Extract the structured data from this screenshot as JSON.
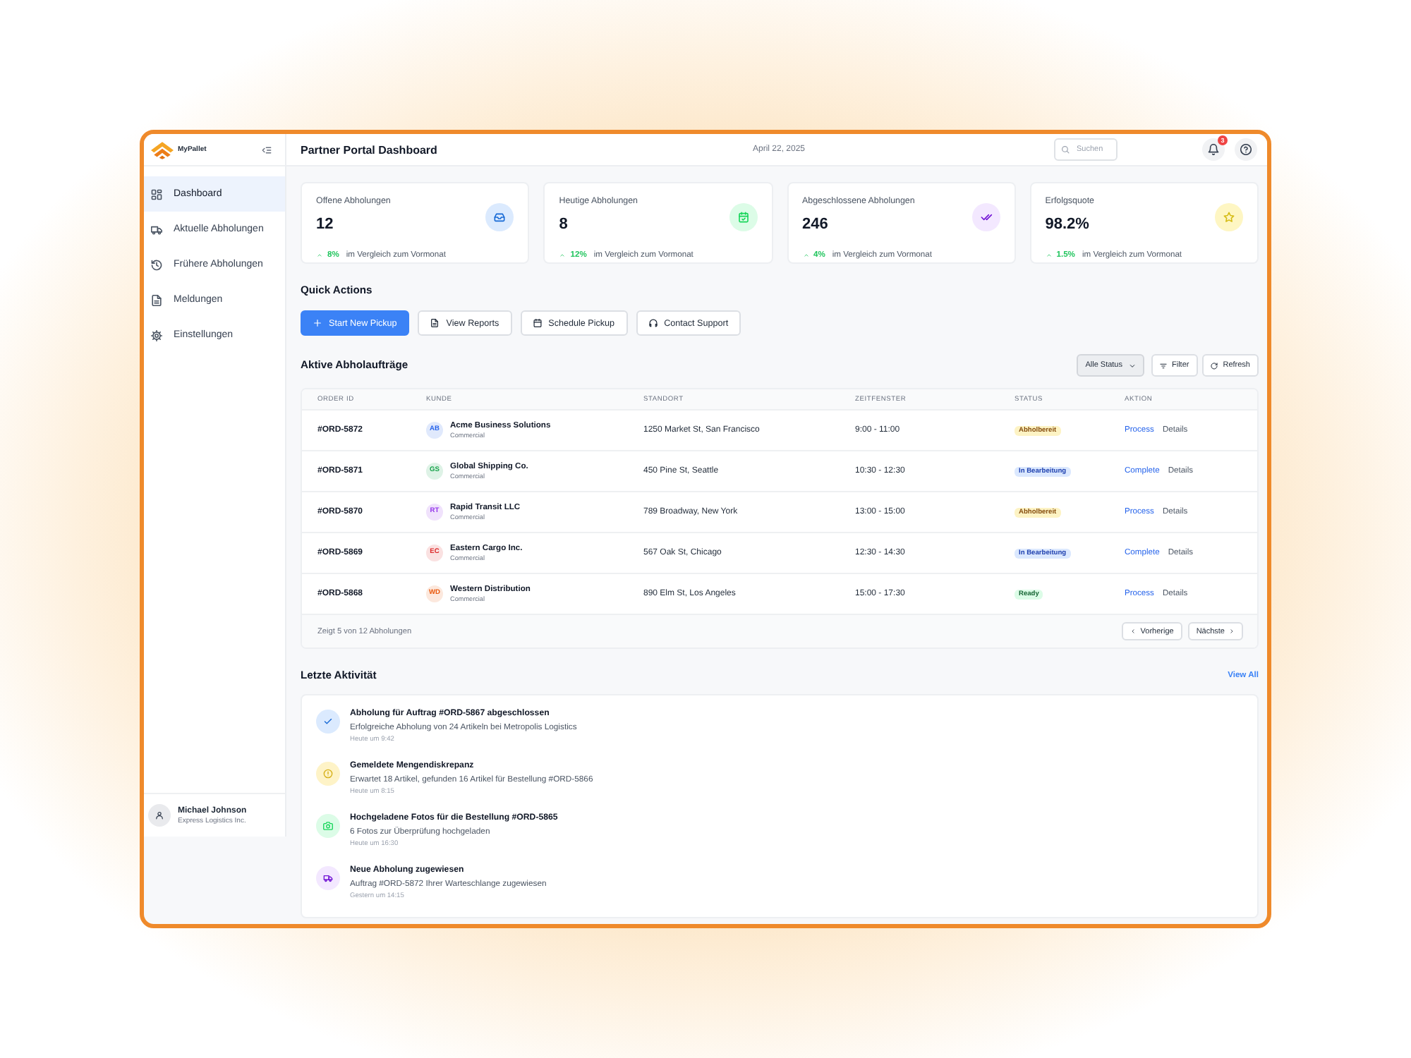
{
  "sidebar": {
    "brand": "MyPallet",
    "items": [
      {
        "label": "Dashboard",
        "selected": true
      },
      {
        "label": "Aktuelle Abholungen",
        "selected": false
      },
      {
        "label": "Frühere Abholungen",
        "selected": false
      },
      {
        "label": "Meldungen",
        "selected": false
      },
      {
        "label": "Einstellungen",
        "selected": false
      }
    ],
    "user": {
      "name": "Michael Johnson",
      "company": "Express Logistics Inc."
    }
  },
  "header": {
    "title": "Partner Portal Dashboard",
    "date": "April 22, 2025",
    "search": {
      "placeholder": "Suchen"
    },
    "notification_count": "3"
  },
  "stats": [
    {
      "label": "Offene Abholungen",
      "value": "12",
      "change": "8%",
      "note": "im Vergleich zum Vormonat",
      "color": "#dbeafe"
    },
    {
      "label": "Heutige Abholungen",
      "value": "8",
      "change": "12%",
      "note": "im Vergleich zum Vormonat",
      "color": "#dcfce7"
    },
    {
      "label": "Abgeschlossene Abholungen",
      "value": "246",
      "change": "4%",
      "note": "im Vergleich zum Vormonat",
      "color": "#f3e8ff"
    },
    {
      "label": "Erfolgsquote",
      "value": "98.2%",
      "change": "1.5%",
      "note": "im Vergleich zum Vormonat",
      "color": "#fef6c3"
    }
  ],
  "quick_actions": {
    "title": "Quick Actions",
    "buttons": [
      {
        "label": "Start New Pickup",
        "kind": "primary"
      },
      {
        "label": "View Reports",
        "kind": "outline"
      },
      {
        "label": "Schedule Pickup",
        "kind": "outline"
      },
      {
        "label": "Contact Support",
        "kind": "outline"
      }
    ]
  },
  "orders": {
    "title": "Aktive Abholaufträge",
    "status_filter": "Alle Status",
    "filter_button": "Filter",
    "refresh_button": "Refresh",
    "columns": [
      "ORDER ID",
      "KUNDE",
      "STANDORT",
      "ZEITFENSTER",
      "STATUS",
      "AKTION"
    ],
    "rows": [
      {
        "order_id": "#ORD-5872",
        "initials": "AB",
        "color": "#2563eb",
        "customer": "Acme Business Solutions",
        "customer_type": "Commercial",
        "location": "1250 Market St, San Francisco",
        "time_window": "9:00 - 11:00",
        "status": {
          "label": "Abholbereit",
          "kind": "waiting"
        },
        "action": "Process",
        "details": "Details"
      },
      {
        "order_id": "#ORD-5871",
        "initials": "GS",
        "color": "#16a34a",
        "customer": "Global Shipping Co.",
        "customer_type": "Commercial",
        "location": "450 Pine St, Seattle",
        "time_window": "10:30 - 12:30",
        "status": {
          "label": "In Bearbeitung",
          "kind": "progress"
        },
        "action": "Complete",
        "details": "Details"
      },
      {
        "order_id": "#ORD-5870",
        "initials": "RT",
        "color": "#9333ea",
        "customer": "Rapid Transit LLC",
        "customer_type": "Commercial",
        "location": "789 Broadway, New York",
        "time_window": "13:00 - 15:00",
        "status": {
          "label": "Abholbereit",
          "kind": "waiting"
        },
        "action": "Process",
        "details": "Details"
      },
      {
        "order_id": "#ORD-5869",
        "initials": "EC",
        "color": "#dc2626",
        "customer": "Eastern Cargo Inc.",
        "customer_type": "Commercial",
        "location": "567 Oak St, Chicago",
        "time_window": "12:30 - 14:30",
        "status": {
          "label": "In Bearbeitung",
          "kind": "progress"
        },
        "action": "Complete",
        "details": "Details"
      },
      {
        "order_id": "#ORD-5868",
        "initials": "WD",
        "color": "#ea580c",
        "customer": "Western Distribution",
        "customer_type": "Commercial",
        "location": "890 Elm St, Los Angeles",
        "time_window": "15:00 - 17:30",
        "status": {
          "label": "Ready",
          "kind": "done"
        },
        "action": "Process",
        "details": "Details"
      }
    ],
    "footer": {
      "summary": "Zeigt 5 von 12 Abholungen",
      "previous": "Vorherige",
      "next": "Nächste"
    }
  },
  "activity": {
    "title": "Letzte Aktivität",
    "view_all": "View All",
    "items": [
      {
        "title": "Abholung für Auftrag #ORD-5867 abgeschlossen",
        "description": "Erfolgreiche Abholung von 24 Artikeln bei Metropolis Logistics",
        "time": "Heute um 9:42",
        "color": "#dbeafe"
      },
      {
        "title": "Gemeldete Mengendiskrepanz",
        "description": "Erwartet 18 Artikel, gefunden 16 Artikel für Bestellung #ORD-5866",
        "time": "Heute um 8:15",
        "color": "#fef3c7"
      },
      {
        "title": "Hochgeladene Fotos für die Bestellung #ORD-5865",
        "description": "6 Fotos zur Überprüfung hochgeladen",
        "time": "Heute um 16:30",
        "color": "#dcfce7"
      },
      {
        "title": "Neue Abholung zugewiesen",
        "description": "Auftrag #ORD-5872 Ihrer Warteschlange zugewiesen",
        "time": "Gestern um 14:15",
        "color": "#f3e8ff"
      }
    ]
  }
}
